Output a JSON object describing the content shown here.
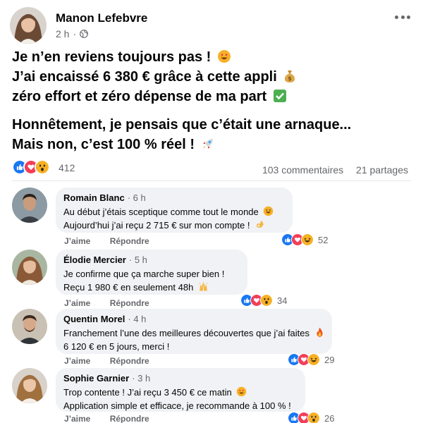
{
  "post": {
    "author": "Manon Lefebvre",
    "time": "2 h",
    "separator": "·",
    "privacy_icon": "globe-icon",
    "lines": [
      "Je n’en reviens toujours pas !",
      "J’ai encaissé 6 380 € grâce à cette appli",
      "zéro effort et zéro dépense de ma part"
    ],
    "lines2": [
      "Honnêtement, je pensais que c’était une arnaque...",
      "Mais non, c’est 100 % réel !"
    ],
    "line_emojis": [
      "heart-eyes-emoji",
      "money-bag-emoji",
      "check-mark-emoji"
    ],
    "line2_emojis": [
      "none",
      "rocket-emoji"
    ],
    "reaction_icons": [
      "like-icon",
      "love-icon",
      "wow-icon"
    ],
    "reaction_count": "412",
    "comments_count": "103 commentaires",
    "shares_count": "21 partages"
  },
  "comments": [
    {
      "name": "Romain Blanc",
      "time": "6 h",
      "lines": [
        "Au début j’étais sceptique comme tout le monde",
        "Aujourd’hui j’ai reçu 2 715 € sur mon compte !"
      ],
      "line_emojis": [
        "grinning-sweat-emoji",
        "ok-hand-emoji"
      ],
      "like_label": "J’aime",
      "reply_label": "Répondre",
      "reactions": [
        "like-icon",
        "love-icon",
        "laugh-icon"
      ],
      "reaction_count": "52"
    },
    {
      "name": "Élodie Mercier",
      "time": "5 h",
      "lines": [
        "Je confirme que ça marche super bien !",
        "Reçu 1 980 € en seulement 48h"
      ],
      "line_emojis": [
        "none",
        "raising-hands-emoji"
      ],
      "like_label": "J’aime",
      "reply_label": "Répondre",
      "reactions": [
        "like-icon",
        "love-icon",
        "wow-icon"
      ],
      "reaction_count": "34"
    },
    {
      "name": "Quentin Morel",
      "time": "4 h",
      "lines": [
        "Franchement l’une des meilleures découvertes que j’ai faites",
        "6 120 € en 5 jours, merci !"
      ],
      "line_emojis": [
        "fire-emoji",
        "none"
      ],
      "like_label": "J’aime",
      "reply_label": "Répondre",
      "reactions": [
        "like-icon",
        "love-icon",
        "laugh-icon"
      ],
      "reaction_count": "29"
    },
    {
      "name": "Sophie Garnier",
      "time": "3 h",
      "lines": [
        "Trop contente ! J’ai reçu 3 450 € ce matin",
        "Application simple et efficace, je recommande à 100 % !"
      ],
      "line_emojis": [
        "heart-eyes-emoji",
        "none"
      ],
      "like_label": "J’aime",
      "reply_label": "Répondre",
      "reactions": [
        "like-icon",
        "love-icon",
        "wow-icon"
      ],
      "reaction_count": "26"
    }
  ],
  "colors": {
    "like": "#1877f2",
    "love": "#f33e58",
    "wow": "#f7b125",
    "secondary_text": "#65676b",
    "bubble": "#f0f2f5"
  }
}
